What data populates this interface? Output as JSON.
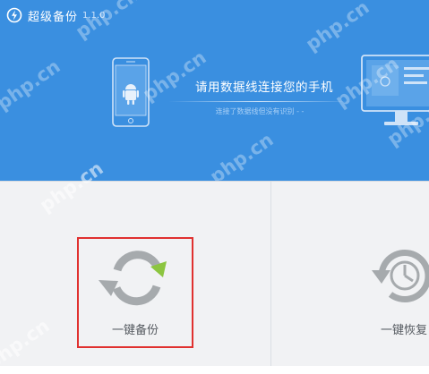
{
  "app": {
    "title": "超级备份",
    "version": "1.1.0"
  },
  "connect": {
    "message": "请用数据线连接您的手机",
    "status": "连接了数据线但没有识别 - -"
  },
  "actions": {
    "backup_label": "一键备份",
    "restore_label": "一键恢复"
  },
  "watermark": "php.cn",
  "colors": {
    "header_bg": "#3a8fe0",
    "panel_bg": "#f1f2f4",
    "highlight_box": "#e0312f",
    "icon_gray": "#a6aaad",
    "icon_green": "#8cc540"
  }
}
